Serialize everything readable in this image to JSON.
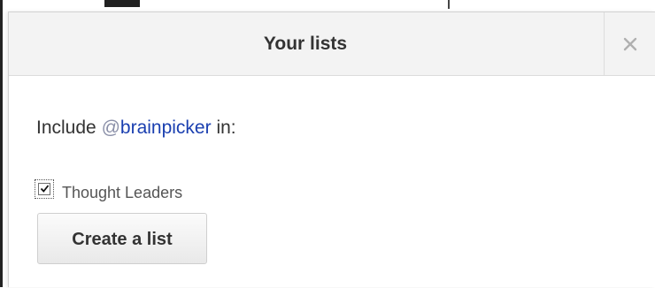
{
  "dialog": {
    "title": "Your lists",
    "close_icon": "close-icon"
  },
  "body": {
    "include_prefix": "Include ",
    "at_symbol": "@",
    "handle": "brainpicker",
    "include_suffix": " in:",
    "lists": [
      {
        "label": "Thought Leaders",
        "checked": true
      }
    ],
    "create_button_label": "Create a list"
  },
  "colors": {
    "header_bg": "#f3f3f3",
    "handle_link": "#1a3fb0",
    "text": "#333333"
  }
}
